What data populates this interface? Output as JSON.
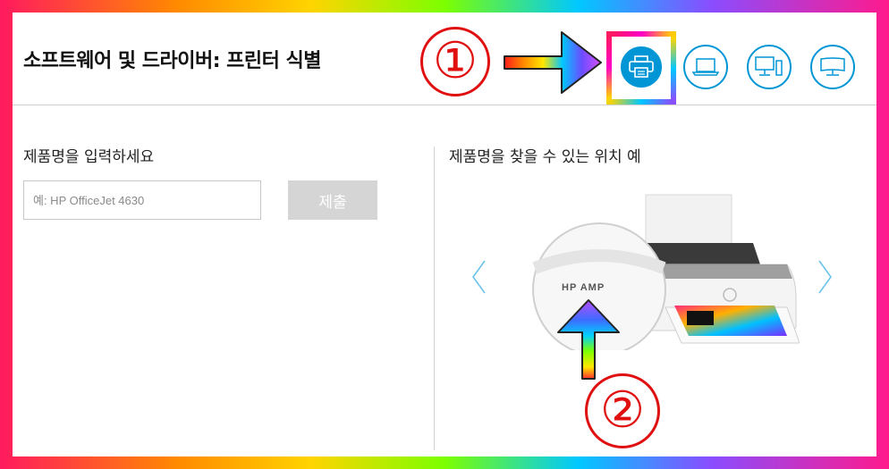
{
  "header": {
    "title": "소프트웨어 및 드라이버: 프린터 식별",
    "device_options": [
      {
        "name": "printer",
        "icon": "printer-icon",
        "selected": true
      },
      {
        "name": "laptop",
        "icon": "laptop-icon",
        "selected": false
      },
      {
        "name": "desktop",
        "icon": "desktop-icon",
        "selected": false
      },
      {
        "name": "monitor",
        "icon": "monitor-icon",
        "selected": false
      }
    ]
  },
  "annotations": {
    "step1": "①",
    "step2": "②"
  },
  "form": {
    "label": "제품명을 입력하세요",
    "placeholder": "예: HP OfficeJet 4630",
    "value": "",
    "submit_label": "제출"
  },
  "example": {
    "label": "제품명을 찾을 수 있는 위치 예",
    "zoom_text": "HP AMP",
    "image": "printer-example-image"
  },
  "colors": {
    "accent": "#0096d6",
    "annotation_red": "#e01010",
    "submit_disabled": "#d5d5d5"
  }
}
